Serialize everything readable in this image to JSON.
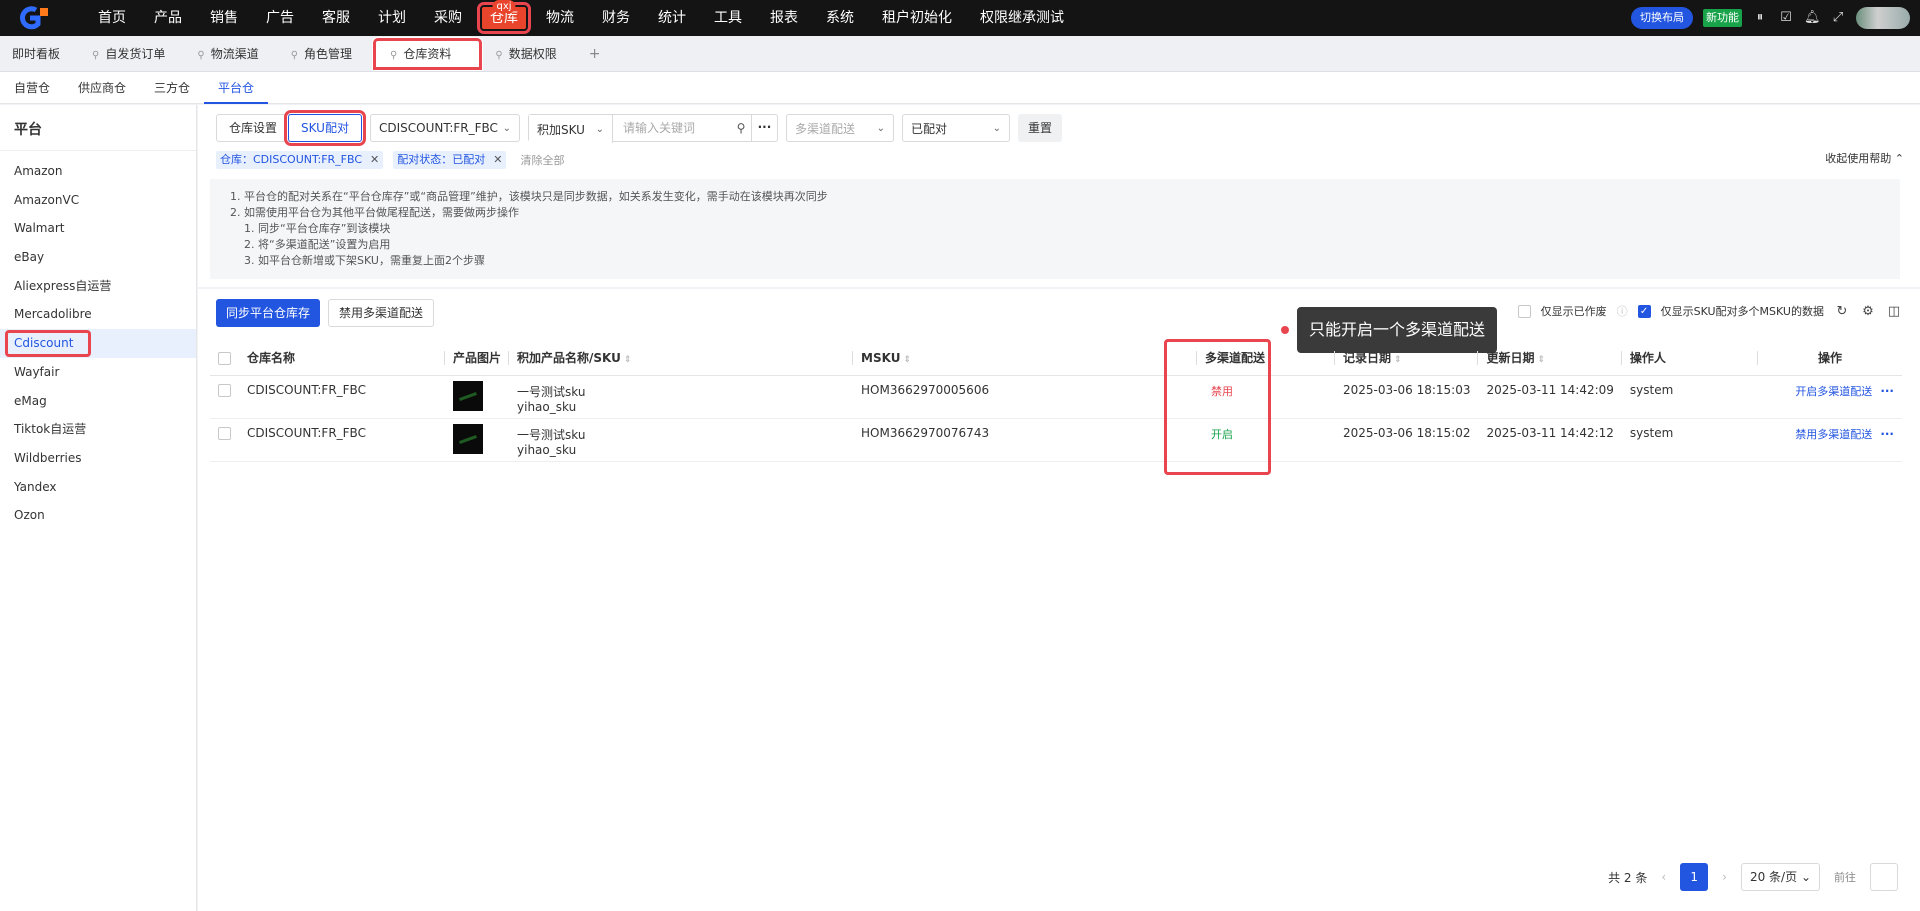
{
  "topnav": {
    "items": [
      "首页",
      "产品",
      "销售",
      "广告",
      "客服",
      "计划",
      "采购",
      "仓库",
      "物流",
      "财务",
      "统计",
      "工具",
      "报表",
      "系统",
      "租户初始化",
      "权限继承测试"
    ],
    "active_badge": "qxj",
    "switch_layout": "切换布局",
    "new_feature": "新功能"
  },
  "page_tabs": [
    "即时看板",
    "自发货订单",
    "物流渠道",
    "角色管理",
    "仓库资料",
    "数据权限",
    "+"
  ],
  "sub_tabs": [
    "自营仓",
    "供应商仓",
    "三方仓",
    "平台仓"
  ],
  "sidebar": {
    "title": "平台",
    "items": [
      "Amazon",
      "AmazonVC",
      "Walmart",
      "eBay",
      "Aliexpress自运营",
      "Mercadolibre",
      "Cdiscount",
      "Wayfair",
      "eMag",
      "Tiktok自运营",
      "Wildberries",
      "Yandex",
      "Ozon"
    ]
  },
  "filters": {
    "seg_settings": "仓库设置",
    "seg_sku": "SKU配对",
    "warehouse": "CDISCOUNT:FR_FBC",
    "search_type": "积加SKU",
    "search_placeholder": "请输入关键词",
    "multi_channel_placeholder": "多渠道配送",
    "pair_status": "已配对",
    "reset": "重置",
    "tag_warehouse": "仓库：CDISCOUNT:FR_FBC",
    "tag_status": "配对状态：已配对",
    "clear_all": "清除全部",
    "help_toggle": "收起使用帮助"
  },
  "help": [
    "1. 平台仓的配对关系在“平台仓库存”或“商品管理”维护，该模块只是同步数据，如关系发生变化，需手动在该模块再次同步",
    "2. 如需使用平台仓为其他平台做尾程配送，需要做两步操作",
    "1. 同步“平台仓库存”到该模块",
    "2. 将“多渠道配送”设置为启用",
    "3. 如平台仓新增或下架SKU，需重复上面2个步骤"
  ],
  "toolbar": {
    "sync": "同步平台仓库存",
    "disable_multi": "禁用多渠道配送",
    "tooltip": "只能开启一个多渠道配送",
    "show_abandoned": "仅显示已作废",
    "show_multi_msku": "仅显示SKU配对多个MSKU的数据"
  },
  "table": {
    "headers": [
      "仓库名称",
      "产品图片",
      "积加产品名称/SKU",
      "MSKU",
      "多渠道配送",
      "记录日期",
      "更新日期",
      "操作人",
      "操作"
    ],
    "rows": [
      {
        "warehouse": "CDISCOUNT:FR_FBC",
        "name": "一号测试sku",
        "sku": "yihao_sku",
        "msku": "HOM3662970005606",
        "multi": "禁用",
        "record": "2025-03-06 18:15:03",
        "update": "2025-03-11 14:42:09",
        "operator": "system",
        "action": "开启多渠道配送"
      },
      {
        "warehouse": "CDISCOUNT:FR_FBC",
        "name": "一号测试sku",
        "sku": "yihao_sku",
        "msku": "HOM3662970076743",
        "multi": "开启",
        "record": "2025-03-06 18:15:02",
        "update": "2025-03-11 14:42:12",
        "operator": "system",
        "action": "禁用多渠道配送"
      }
    ]
  },
  "pager": {
    "total": "共 2 条",
    "page": "1",
    "size": "20 条/页",
    "goto": "前往"
  },
  "colors": {
    "primary": "#2255e0",
    "highlight": "#e8454f",
    "dark": "#141414"
  }
}
